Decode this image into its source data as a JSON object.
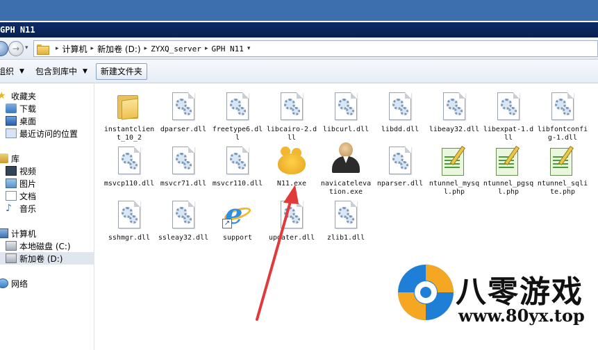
{
  "window": {
    "title": "GPH N11"
  },
  "address_bar": {
    "crumbs": [
      "计算机",
      "新加卷 (D:)",
      "ZYXQ_server",
      "GPH N11"
    ]
  },
  "toolbar": {
    "organize_label": "组织",
    "include_label": "包含到库中",
    "new_folder_label": "新建文件夹"
  },
  "sidebar": {
    "favorites": "收藏夹",
    "downloads": "下载",
    "desktop": "桌面",
    "recent": "最近访问的位置",
    "libraries": "库",
    "videos": "视频",
    "pictures": "图片",
    "documents": "文档",
    "music": "音乐",
    "computer": "计算机",
    "local_disk": "本地磁盘 (C:)",
    "new_volume": "新加卷 (D:)",
    "network": "网络"
  },
  "files": [
    {
      "name": "instantclient_10_2",
      "type": "folder-icon"
    },
    {
      "name": "dparser.dll",
      "type": "dll-icon"
    },
    {
      "name": "freetype6.dll",
      "type": "dll-icon"
    },
    {
      "name": "libcairo-2.dll",
      "type": "dll-icon"
    },
    {
      "name": "libcurl.dll",
      "type": "dll-icon"
    },
    {
      "name": "libdd.dll",
      "type": "dll-icon"
    },
    {
      "name": "libeay32.dll",
      "type": "dll-icon"
    },
    {
      "name": "libexpat-1.dll",
      "type": "dll-icon"
    },
    {
      "name": "libfontconfig-1.dll",
      "type": "dll-icon"
    },
    {
      "name": "msvcp110.dll",
      "type": "dll-icon"
    },
    {
      "name": "msvcr71.dll",
      "type": "dll-icon"
    },
    {
      "name": "msvcr110.dll",
      "type": "dll-icon"
    },
    {
      "name": "N11.exe",
      "type": "navicat-icon"
    },
    {
      "name": "navicatelevation.exe",
      "type": "user-icon"
    },
    {
      "name": "nparser.dll",
      "type": "dll-icon"
    },
    {
      "name": "ntunnel_mysql.php",
      "type": "php-icon"
    },
    {
      "name": "ntunnel_pgsql.php",
      "type": "php-icon"
    },
    {
      "name": "ntunnel_sqlite.php",
      "type": "php-icon"
    },
    {
      "name": "sshmgr.dll",
      "type": "dll-icon"
    },
    {
      "name": "ssleay32.dll",
      "type": "dll-icon"
    },
    {
      "name": "support",
      "type": "ie-shortcut-icon"
    },
    {
      "name": "updater.dll",
      "type": "dll-icon"
    },
    {
      "name": "zlib1.dll",
      "type": "dll-icon"
    }
  ],
  "watermark": {
    "brand": "八零游戏",
    "url": "www.80yx.top"
  },
  "colors": {
    "title_bar": "#0d2b6a",
    "selection": "#dfe6ee",
    "annotation_arrow": "#e03a3a"
  }
}
